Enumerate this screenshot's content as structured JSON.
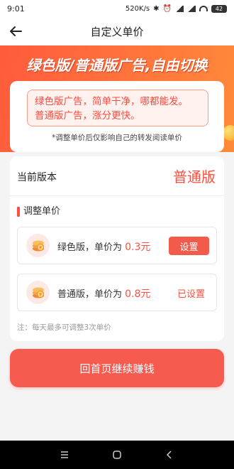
{
  "status_bar": {
    "time": "9:01",
    "speed": "520K/s",
    "battery": "42"
  },
  "nav": {
    "title": "自定义单价"
  },
  "banner": {
    "title": "绿色版/普通版广告,自由切换",
    "note_line1": "绿色版广告，简单干净，哪都能发。",
    "note_line2": "普通版广告，涨分更快。",
    "hint": "*调整单价后仅影响自己的转发阅读单价"
  },
  "current_version": {
    "label": "当前版本",
    "value": "普通版"
  },
  "adjust": {
    "title": "调整单价",
    "options": [
      {
        "name": "绿色版，单价为 ",
        "price": "0.3元",
        "action": "设置"
      },
      {
        "name": "普通版，单价为 ",
        "price": "0.8元",
        "action": "已设置"
      }
    ],
    "tip": "注：每天最多可调整3次单价"
  },
  "cta": {
    "label": "回首页继续赚钱"
  },
  "colors": {
    "accent": "#ff4e3e",
    "banner": "#ff6d3c",
    "button": "#f75b50"
  }
}
